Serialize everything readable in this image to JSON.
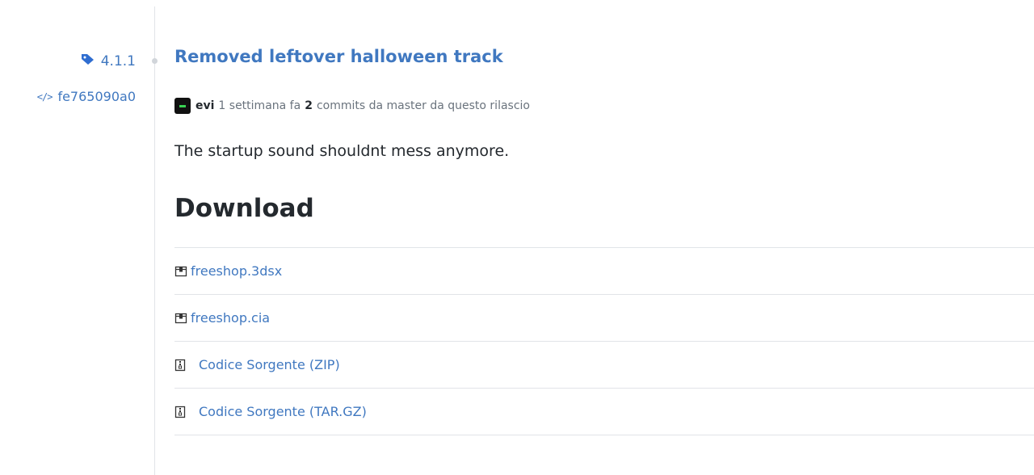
{
  "release": {
    "tag": "4.1.1",
    "commit": "fe765090a0",
    "title": "Removed leftover halloween track",
    "author": "evi",
    "time_ago": "1 settimana fa",
    "commit_count": "2",
    "commits_suffix": "commits da master da questo rilascio",
    "description": "The startup sound shouldnt mess anymore."
  },
  "downloads": {
    "heading": "Download",
    "items": [
      {
        "label": "freeshop.3dsx",
        "icon": "package-icon"
      },
      {
        "label": "freeshop.cia",
        "icon": "package-icon"
      },
      {
        "label": "Codice Sorgente (ZIP)",
        "icon": "file-zip-icon"
      },
      {
        "label": "Codice Sorgente (TAR.GZ)",
        "icon": "file-zip-icon"
      }
    ]
  },
  "colors": {
    "link": "#4078c0",
    "text": "#24292e",
    "muted": "#6a737d",
    "border": "#e1e4e8"
  }
}
